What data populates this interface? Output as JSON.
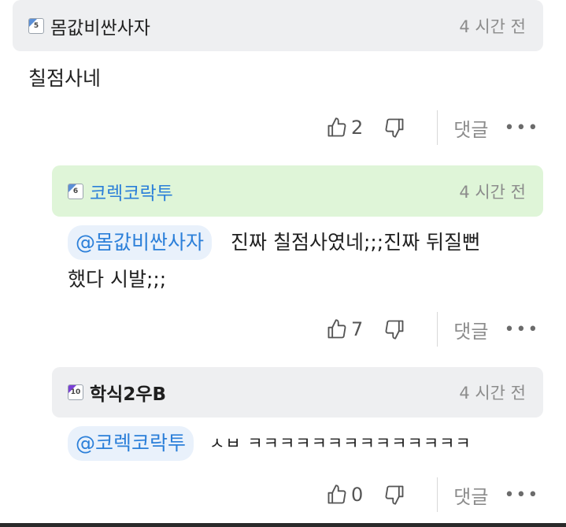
{
  "comments": [
    {
      "level": "5",
      "level_color": "#5b8fd6",
      "username": "몸값비싼사자",
      "time": "4 시간 전",
      "text": "칠점사네",
      "likes": "2",
      "reply_label": "댓글",
      "more": "•••"
    },
    {
      "level": "6",
      "level_color": "#5b8fd6",
      "username": "코렉코락투",
      "time": "4 시간 전",
      "mention": "@몸값비싼사자",
      "text_line1": "진짜 칠점사였네;;;진짜 뒤질뻔",
      "text_line2": "했다 시발;;;",
      "likes": "7",
      "reply_label": "댓글",
      "more": "•••"
    },
    {
      "level": "10",
      "level_color": "#7a3fd6",
      "username": "학식2우B",
      "time": "4 시간 전",
      "mention": "@코렉코락투",
      "text": "ㅅㅂ ㅋㅋㅋㅋㅋㅋㅋㅋㅋㅋㅋㅋㅋㅋ",
      "likes": "0",
      "reply_label": "댓글",
      "more": "•••"
    }
  ],
  "colors": {
    "header_gray": "#eeeff1",
    "header_green": "#dff5d8",
    "mention_blue": "#2b7fd9",
    "mention_bg": "#e9f1fb"
  }
}
